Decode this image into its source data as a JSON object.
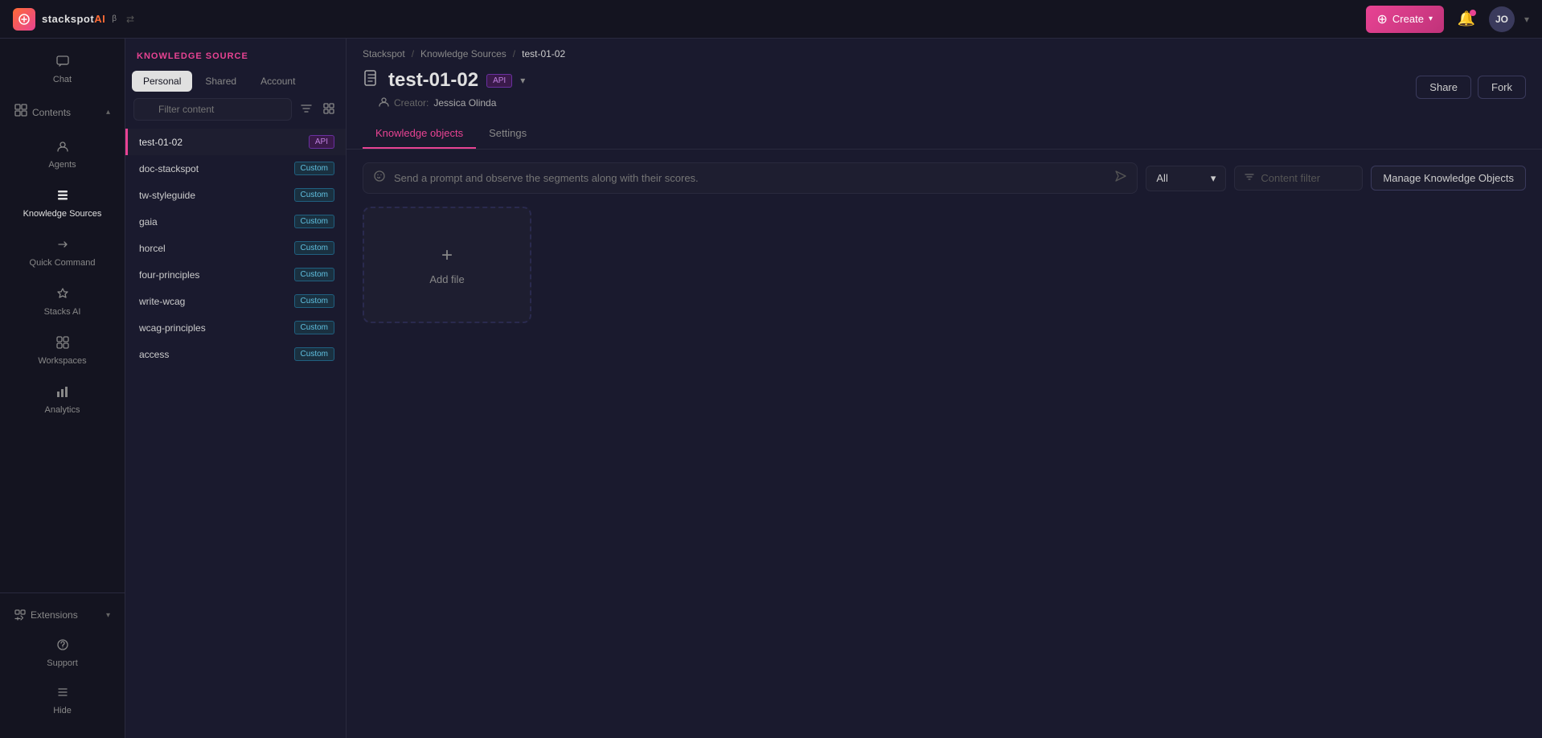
{
  "app": {
    "title": "stackspot",
    "logo_text": "stackspot",
    "ai_label": "AI",
    "beta_label": "β"
  },
  "topbar": {
    "create_label": "Create",
    "avatar_initials": "JO"
  },
  "sidebar": {
    "items": [
      {
        "id": "chat",
        "label": "Chat",
        "icon": "💬"
      },
      {
        "id": "contents",
        "label": "Contents",
        "icon": "⊞"
      },
      {
        "id": "agents",
        "label": "Agents",
        "icon": "🤖"
      },
      {
        "id": "knowledge-sources",
        "label": "Knowledge Sources",
        "icon": "📚"
      },
      {
        "id": "quick-command",
        "label": "Quick Command",
        "icon": "⚡"
      },
      {
        "id": "stacks-ai",
        "label": "Stacks AI",
        "icon": "◈"
      },
      {
        "id": "workspaces",
        "label": "Workspaces",
        "icon": "⊡"
      },
      {
        "id": "analytics",
        "label": "Analytics",
        "icon": "📊"
      }
    ],
    "extensions_label": "Extensions",
    "support_label": "Support",
    "hide_label": "Hide"
  },
  "ks_panel": {
    "header": "KNOWLEDGE SOURCE",
    "tabs": [
      "Personal",
      "Shared",
      "Account"
    ],
    "active_tab": "Personal",
    "search_placeholder": "Filter content",
    "items": [
      {
        "name": "test-01-02",
        "badge": "API",
        "badge_type": "api",
        "active": true
      },
      {
        "name": "doc-stackspot",
        "badge": "Custom",
        "badge_type": "custom"
      },
      {
        "name": "tw-styleguide",
        "badge": "Custom",
        "badge_type": "custom"
      },
      {
        "name": "gaia",
        "badge": "Custom",
        "badge_type": "custom"
      },
      {
        "name": "horcel",
        "badge": "Custom",
        "badge_type": "custom"
      },
      {
        "name": "four-principles",
        "badge": "Custom",
        "badge_type": "custom"
      },
      {
        "name": "write-wcag",
        "badge": "Custom",
        "badge_type": "custom"
      },
      {
        "name": "wcag-principles",
        "badge": "Custom",
        "badge_type": "custom"
      },
      {
        "name": "access",
        "badge": "Custom",
        "badge_type": "custom"
      }
    ]
  },
  "breadcrumb": {
    "items": [
      "Stackspot",
      "Knowledge Sources",
      "test-01-02"
    ],
    "separators": [
      "/",
      "/"
    ]
  },
  "detail": {
    "title": "test-01-02",
    "api_badge": "API",
    "creator_label": "Creator:",
    "creator_name": "Jessica Olinda",
    "share_btn": "Share",
    "fork_btn": "Fork",
    "tabs": [
      "Knowledge objects",
      "Settings"
    ],
    "active_tab": "Knowledge objects"
  },
  "content": {
    "prompt_placeholder": "Send a prompt and observe the segments along with their scores.",
    "all_option": "All",
    "content_filter_placeholder": "Content filter",
    "manage_btn": "Manage Knowledge Objects",
    "add_file_label": "Add file"
  }
}
